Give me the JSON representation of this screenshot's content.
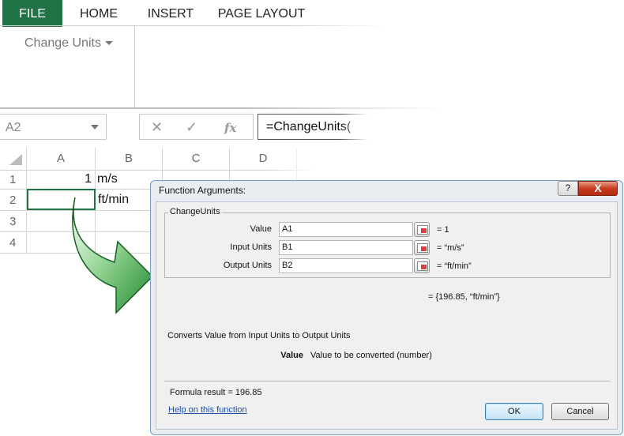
{
  "ribbon": {
    "tabs": [
      {
        "label": "FILE",
        "active": true
      },
      {
        "label": "HOME",
        "active": false
      },
      {
        "label": "INSERT",
        "active": false
      },
      {
        "label": "PAGE LAYOUT",
        "active": false
      }
    ],
    "change_units_label": "Change Units"
  },
  "formula_bar": {
    "name_box": "A2",
    "cancel_icon": "✕",
    "enter_icon": "✓",
    "fx_icon": "fx",
    "formula": "=ChangeUnits("
  },
  "sheet": {
    "columns": [
      "A",
      "B",
      "C",
      "D"
    ],
    "rows": [
      "1",
      "2",
      "3",
      "4"
    ],
    "cells": {
      "A1": "1",
      "B1": "m/s",
      "B2": "ft/min"
    },
    "selected": "A2"
  },
  "dialog": {
    "title": "Function Arguments:",
    "help_label": "?",
    "close_label": "X",
    "group_label": "ChangeUnits",
    "args": [
      {
        "label": "Value",
        "input": "A1",
        "result": "= 1"
      },
      {
        "label": "Input Units",
        "input": "B1",
        "result": "= “m/s”"
      },
      {
        "label": "Output Units",
        "input": "B2",
        "result": "= “ft/min”"
      }
    ],
    "overall_result": "= {196.85, “ft/min”}",
    "description": "Converts Value from Input Units to Output Units",
    "param_name": "Value",
    "param_description": "Value to be converted (number)",
    "formula_result": "Formula result = 196.85",
    "help_link": "Help on this function",
    "ok_label": "OK",
    "cancel_label": "Cancel"
  },
  "colors": {
    "accent": "#217346",
    "close_button": "#c83d22",
    "link": "#1a4fb0"
  }
}
